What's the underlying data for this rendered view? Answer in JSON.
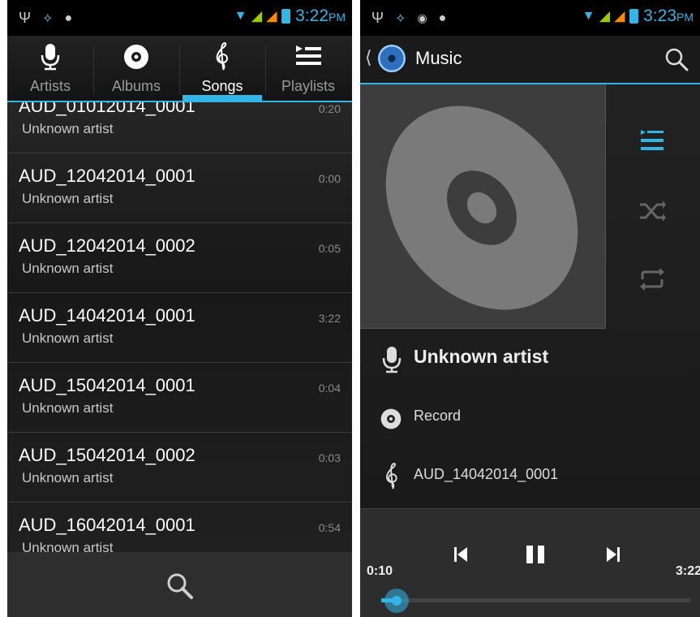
{
  "left": {
    "status": {
      "time": "3:22",
      "ampm": "PM"
    },
    "tabs": [
      {
        "label": "Artists"
      },
      {
        "label": "Albums"
      },
      {
        "label": "Songs"
      },
      {
        "label": "Playlists"
      }
    ],
    "songs": [
      {
        "title": "AUD_01012014_0001",
        "artist": "Unknown artist",
        "duration": "0:20"
      },
      {
        "title": "AUD_12042014_0001",
        "artist": "Unknown artist",
        "duration": "0:00"
      },
      {
        "title": "AUD_12042014_0002",
        "artist": "Unknown artist",
        "duration": "0:05"
      },
      {
        "title": "AUD_14042014_0001",
        "artist": "Unknown artist",
        "duration": "3:22"
      },
      {
        "title": "AUD_15042014_0001",
        "artist": "Unknown artist",
        "duration": "0:04"
      },
      {
        "title": "AUD_15042014_0002",
        "artist": "Unknown artist",
        "duration": "0:03"
      },
      {
        "title": "AUD_16042014_0001",
        "artist": "Unknown artist",
        "duration": "0:54"
      }
    ]
  },
  "right": {
    "status": {
      "time": "3:23",
      "ampm": "PM"
    },
    "title": "Music",
    "artist": "Unknown artist",
    "album": "Record",
    "track": "AUD_14042014_0001",
    "current_time": "0:10",
    "total_time": "3:22",
    "progress_fraction": 0.05
  },
  "colors": {
    "accent": "#33b5e5"
  }
}
